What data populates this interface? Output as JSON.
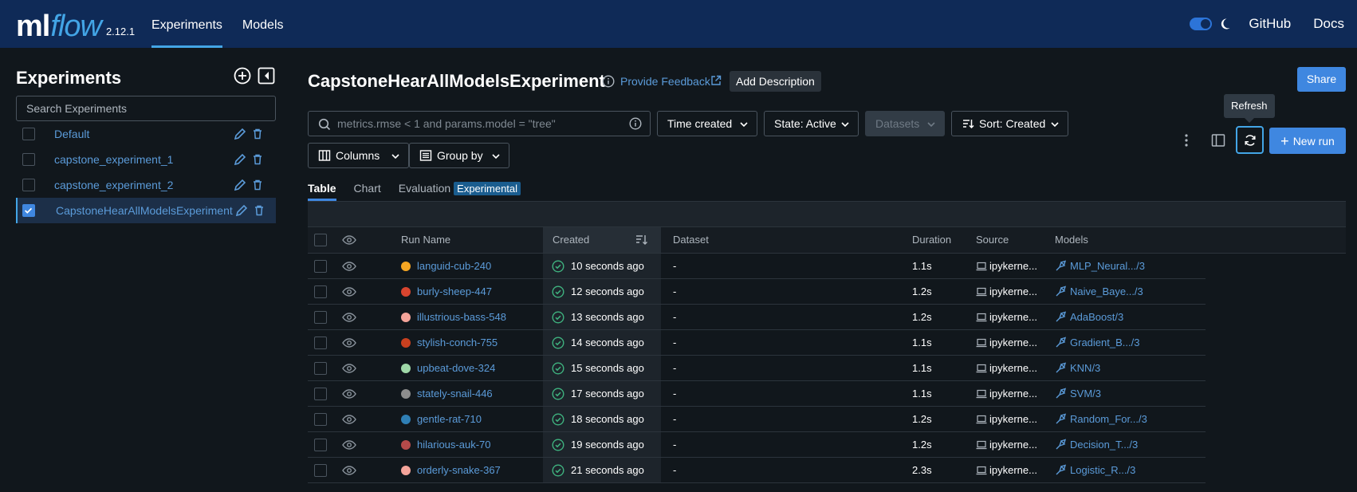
{
  "app": {
    "logo_ml": "ml",
    "logo_flow": "flow",
    "version": "2.12.1",
    "nav": [
      "Experiments",
      "Models"
    ],
    "links": [
      "GitHub",
      "Docs"
    ]
  },
  "sidebar": {
    "title": "Experiments",
    "search_placeholder": "Search Experiments",
    "experiments": [
      {
        "name": "Default",
        "selected": false
      },
      {
        "name": "capstone_experiment_1",
        "selected": false
      },
      {
        "name": "capstone_experiment_2",
        "selected": false
      },
      {
        "name": "CapstoneHearAllModelsExperiment",
        "selected": true
      }
    ]
  },
  "header": {
    "title": "CapstoneHearAllModelsExperiment",
    "feedback": "Provide Feedback",
    "add_description": "Add Description",
    "share": "Share"
  },
  "filters": {
    "search_placeholder": "metrics.rmse < 1 and params.model = \"tree\"",
    "time_created": "Time created",
    "state": "State: Active",
    "datasets": "Datasets",
    "sort": "Sort: Created",
    "columns": "Columns",
    "group_by": "Group by",
    "refresh_tooltip": "Refresh",
    "new_run": "New run"
  },
  "tabs": {
    "table": "Table",
    "chart": "Chart",
    "evaluation": "Evaluation",
    "experimental": "Experimental"
  },
  "table": {
    "headers": {
      "run_name": "Run Name",
      "created": "Created",
      "dataset": "Dataset",
      "duration": "Duration",
      "source": "Source",
      "models": "Models"
    },
    "rows": [
      {
        "name": "languid-cub-240",
        "color": "#f5a623",
        "created": "10 seconds ago",
        "dataset": "-",
        "duration": "1.1s",
        "source": "ipykerne...",
        "model": "MLP_Neural.../3"
      },
      {
        "name": "burly-sheep-447",
        "color": "#d9452f",
        "created": "12 seconds ago",
        "dataset": "-",
        "duration": "1.2s",
        "source": "ipykerne...",
        "model": "Naive_Baye.../3"
      },
      {
        "name": "illustrious-bass-548",
        "color": "#f4a49a",
        "created": "13 seconds ago",
        "dataset": "-",
        "duration": "1.2s",
        "source": "ipykerne...",
        "model": "AdaBoost/3"
      },
      {
        "name": "stylish-conch-755",
        "color": "#c9401f",
        "created": "14 seconds ago",
        "dataset": "-",
        "duration": "1.1s",
        "source": "ipykerne...",
        "model": "Gradient_B.../3"
      },
      {
        "name": "upbeat-dove-324",
        "color": "#9fd8a8",
        "created": "15 seconds ago",
        "dataset": "-",
        "duration": "1.1s",
        "source": "ipykerne...",
        "model": "KNN/3"
      },
      {
        "name": "stately-snail-446",
        "color": "#8d8d8d",
        "created": "17 seconds ago",
        "dataset": "-",
        "duration": "1.1s",
        "source": "ipykerne...",
        "model": "SVM/3"
      },
      {
        "name": "gentle-rat-710",
        "color": "#2f7fb5",
        "created": "18 seconds ago",
        "dataset": "-",
        "duration": "1.2s",
        "source": "ipykerne...",
        "model": "Random_For.../3"
      },
      {
        "name": "hilarious-auk-70",
        "color": "#b44a4a",
        "created": "19 seconds ago",
        "dataset": "-",
        "duration": "1.2s",
        "source": "ipykerne...",
        "model": "Decision_T.../3"
      },
      {
        "name": "orderly-snake-367",
        "color": "#f4a49a",
        "created": "21 seconds ago",
        "dataset": "-",
        "duration": "2.3s",
        "source": "ipykerne...",
        "model": "Logistic_R.../3"
      }
    ]
  }
}
